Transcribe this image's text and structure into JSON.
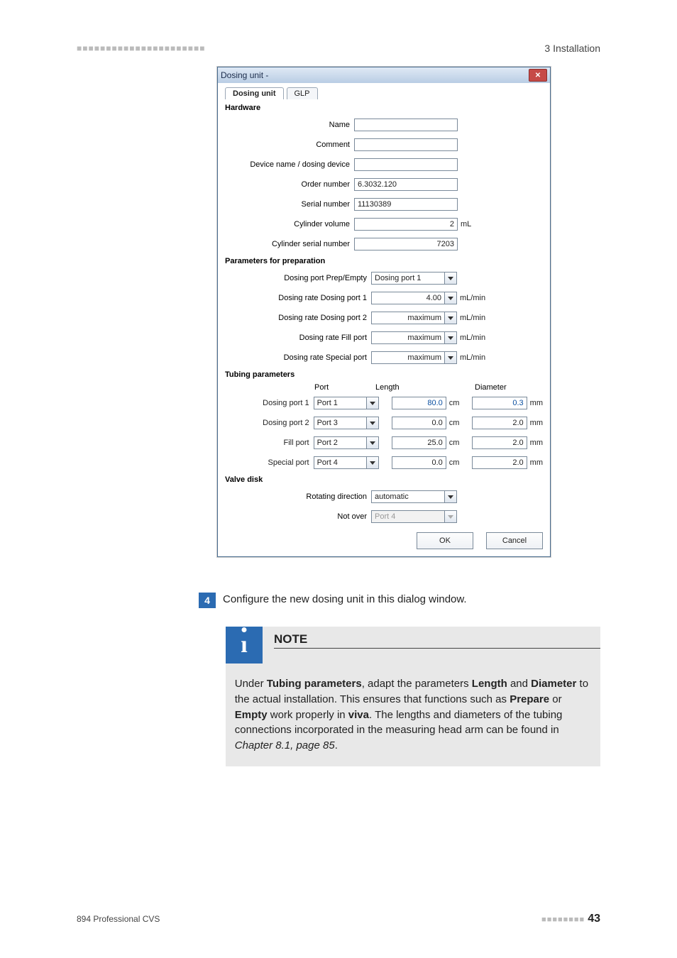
{
  "header": {
    "right": "3 Installation"
  },
  "dialog": {
    "title": "Dosing unit -",
    "tabs": {
      "active": "Dosing unit",
      "other": "GLP"
    },
    "sections": {
      "hardware": {
        "title": "Hardware",
        "name_label": "Name",
        "name_value": "",
        "comment_label": "Comment",
        "comment_value": "",
        "device_label": "Device name / dosing device",
        "device_value": "",
        "order_label": "Order number",
        "order_value": "6.3032.120",
        "serial_label": "Serial number",
        "serial_value": "11130389",
        "cylvol_label": "Cylinder volume",
        "cylvol_value": "2",
        "cylvol_unit": "mL",
        "cylserial_label": "Cylinder serial number",
        "cylserial_value": "7203"
      },
      "prep": {
        "title": "Parameters for preparation",
        "dpe_label": "Dosing port Prep/Empty",
        "dpe_value": "Dosing port 1",
        "r1_label": "Dosing rate Dosing port 1",
        "r1_value": "4.00",
        "r_unit": "mL/min",
        "r2_label": "Dosing rate Dosing port 2",
        "r2_value": "maximum",
        "rf_label": "Dosing rate Fill port",
        "rf_value": "maximum",
        "rs_label": "Dosing rate Special port",
        "rs_value": "maximum"
      },
      "tubing": {
        "title": "Tubing parameters",
        "head_port": "Port",
        "head_len": "Length",
        "head_dia": "Diameter",
        "rows": [
          {
            "label": "Dosing port 1",
            "port": "Port 1",
            "len": "80.0",
            "dia": "0.3",
            "edit": true
          },
          {
            "label": "Dosing port 2",
            "port": "Port 3",
            "len": "0.0",
            "dia": "2.0",
            "edit": false
          },
          {
            "label": "Fill port",
            "port": "Port 2",
            "len": "25.0",
            "dia": "2.0",
            "edit": false
          },
          {
            "label": "Special port",
            "port": "Port 4",
            "len": "0.0",
            "dia": "2.0",
            "edit": false
          }
        ],
        "len_unit": "cm",
        "dia_unit": "mm"
      },
      "valve": {
        "title": "Valve disk",
        "rot_label": "Rotating direction",
        "rot_value": "automatic",
        "notover_label": "Not over",
        "notover_value": "Port 4"
      }
    },
    "buttons": {
      "ok": "OK",
      "cancel": "Cancel"
    }
  },
  "step": {
    "num": "4",
    "text": "Configure the new dosing unit in this dialog window."
  },
  "note": {
    "title": "NOTE",
    "body_parts": {
      "p1": "Under ",
      "b1": "Tubing parameters",
      "p2": ", adapt the parameters ",
      "b2": "Length",
      "p3": " and ",
      "b3": "Diameter",
      "p4": " to the actual installation. This ensures that functions such as ",
      "b4": "Prepare",
      "p5": " or ",
      "b5": "Empty",
      "p6": " work properly in ",
      "b6": "viva",
      "p7": ". The lengths and diameters of the tubing connections incorporated in the measuring head arm can be found in ",
      "i1": "Chapter 8.1, page 85",
      "p8": "."
    }
  },
  "footer": {
    "left": "894 Professional CVS",
    "page": "43"
  }
}
